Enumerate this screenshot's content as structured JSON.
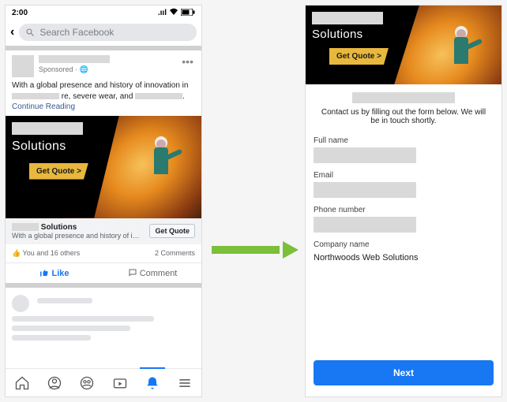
{
  "status": {
    "time": "2:00",
    "signal": "▮▮▮",
    "wifi": "✦",
    "battery": "▭"
  },
  "search": {
    "placeholder": "Search Facebook"
  },
  "post": {
    "sponsored": "Sponsored · 🌐",
    "body_prefix": "With a global presence and history of innovation in",
    "body_mid": "re, severe wear, and",
    "continue": "Continue Reading",
    "ad": {
      "title": "Solutions",
      "cta": "Get Quote >"
    },
    "link": {
      "title_suffix": "Solutions",
      "subtitle": "With a global presence and history of i…",
      "button": "Get Quote"
    },
    "social": {
      "likes_text": "You and 16 others",
      "comments_text": "2 Comments"
    },
    "actions": {
      "like": "Like",
      "comment": "Comment"
    }
  },
  "nav": [
    "home",
    "profile",
    "groups",
    "video",
    "notifications",
    "menu"
  ],
  "form": {
    "intro": "Contact us by filling out the form below.  We will be in touch shortly.",
    "fields": {
      "full_name": {
        "label": "Full name",
        "value": ""
      },
      "email": {
        "label": "Email",
        "value": ""
      },
      "phone": {
        "label": "Phone number",
        "value": ""
      },
      "company": {
        "label": "Company name",
        "value": "Northwoods Web Solutions"
      }
    },
    "next": "Next"
  }
}
